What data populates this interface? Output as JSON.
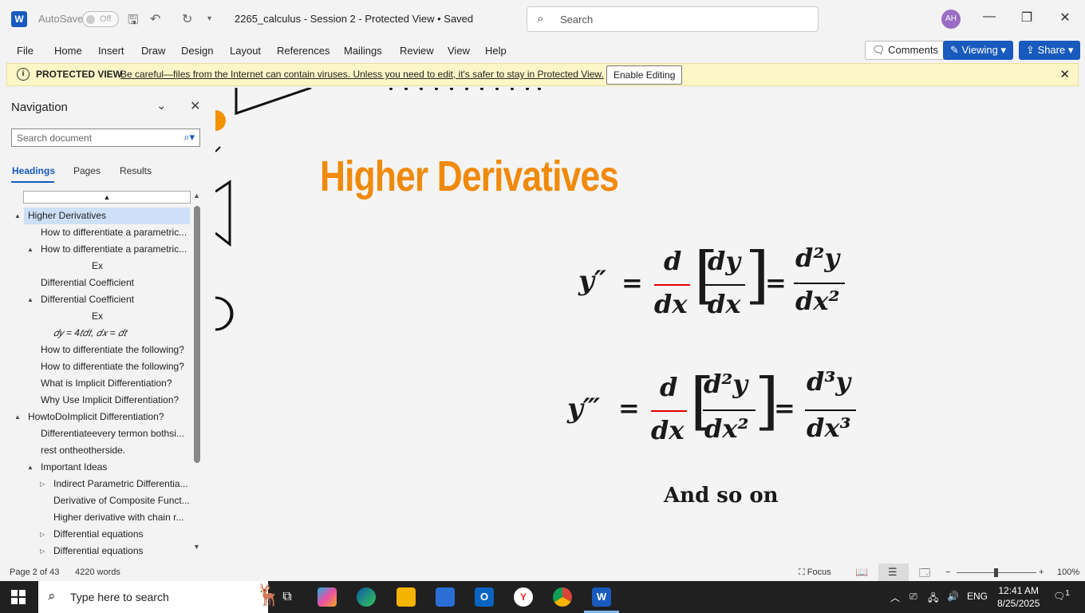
{
  "titlebar": {
    "app_logo": "W",
    "autosave_label": "AutoSave",
    "autosave_state": "Off",
    "document_title": "2265_calculus - Session 2  -  Protected View  •  Saved",
    "search_placeholder": "Search",
    "avatar_initials": "AH",
    "minimize": "—",
    "restore": "❐",
    "close": "✕"
  },
  "ribbon": {
    "tabs": [
      "File",
      "Home",
      "Insert",
      "Draw",
      "Design",
      "Layout",
      "References",
      "Mailings",
      "Review",
      "View",
      "Help"
    ],
    "comments_label": "Comments",
    "viewing_label": "Viewing",
    "share_label": "Share"
  },
  "protected_view": {
    "title": "PROTECTED VIEW",
    "message": "Be careful—files from the Internet can contain viruses. Unless you need to edit, it's safer to stay in Protected View.",
    "enable_editing": "Enable Editing"
  },
  "navigation": {
    "title": "Navigation",
    "search_placeholder": "Search document",
    "tabs": [
      "Headings",
      "Pages",
      "Results"
    ],
    "active_tab": "Headings",
    "items": [
      {
        "label": "Higher Derivatives",
        "level": 1,
        "expander": "▲",
        "selected": true
      },
      {
        "label": "How to differentiate a parametric...",
        "level": 2,
        "expander": ""
      },
      {
        "label": "How to differentiate a parametric...",
        "level": 2,
        "expander": "▲"
      },
      {
        "label": "Ex",
        "level": 4,
        "expander": ""
      },
      {
        "label": "Differential Coefficient",
        "level": 2,
        "expander": ""
      },
      {
        "label": "Differential Coefficient",
        "level": 2,
        "expander": "▲"
      },
      {
        "label": "Ex",
        "level": 4,
        "expander": ""
      },
      {
        "label": "𝑑𝑦 = 4𝑡𝑑𝑡, 𝑑𝑥 =  𝑑𝑡",
        "level": 3,
        "expander": ""
      },
      {
        "label": "How to differentiate the following?",
        "level": 2,
        "expander": ""
      },
      {
        "label": "How to differentiate the following?",
        "level": 2,
        "expander": ""
      },
      {
        "label": "What is Implicit Differentiation?",
        "level": 2,
        "expander": ""
      },
      {
        "label": "Why Use Implicit Differentiation?",
        "level": 2,
        "expander": ""
      },
      {
        "label": "HowtoDoImplicit Differentiation?",
        "level": 1,
        "expander": "▲"
      },
      {
        "label": "Differentiateevery termon bothsi...",
        "level": 2,
        "expander": ""
      },
      {
        "label": "rest ontheotherside.",
        "level": 2,
        "expander": ""
      },
      {
        "label": "Important Ideas",
        "level": 2,
        "expander": "▲"
      },
      {
        "label": "Indirect Parametric Differentia...",
        "level": 3,
        "expander": "▷"
      },
      {
        "label": "Derivative of Composite Funct...",
        "level": 3,
        "expander": ""
      },
      {
        "label": "Higher derivative with chain r...",
        "level": 3,
        "expander": ""
      },
      {
        "label": "Differential equations",
        "level": 3,
        "expander": "▷"
      },
      {
        "label": "Differential equations",
        "level": 3,
        "expander": "▷"
      }
    ]
  },
  "document": {
    "heading": "Higher Derivatives",
    "formula1": {
      "lhs": "y″",
      "eq": "=",
      "d": "d",
      "dx": "dx",
      "inner_num": "dy",
      "inner_den": "dx",
      "rhs_num": "d²y",
      "rhs_den": "dx²"
    },
    "formula2": {
      "lhs": "y‴",
      "eq": "=",
      "d": "d",
      "dx": "dx",
      "inner_num": "d²y",
      "inner_den": "dx²",
      "rhs_num": "d³y",
      "rhs_den": "dx³"
    },
    "closing": "And so on"
  },
  "statusbar": {
    "page": "Page 2 of 43",
    "words": "4220 words",
    "focus": "Focus",
    "zoom": "100%"
  },
  "taskbar": {
    "search_placeholder": "Type here to search",
    "language": "ENG",
    "time": "12:41 AM",
    "date": "8/25/2025",
    "notifications": "1"
  },
  "colors": {
    "heading_orange": "#f08a0b",
    "formula_red": "#e60000",
    "word_blue": "#185abd",
    "protected_bar": "#fdf6c7"
  }
}
